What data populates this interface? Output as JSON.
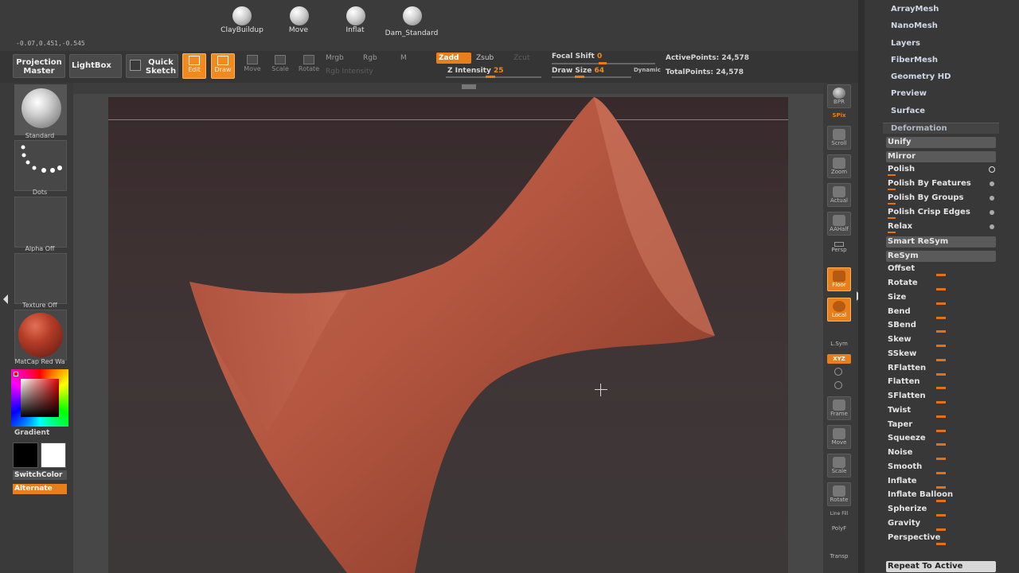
{
  "top_shelf": {
    "brushes": [
      "ClayBuildup",
      "Move",
      "Inflat",
      "Dam_Standard"
    ],
    "coords": "-0.07,0.451,-0.545"
  },
  "toolbar": {
    "projection_master": "Projection Master",
    "lightbox": "LightBox",
    "quick_sketch": "Quick Sketch",
    "edit": "Edit",
    "draw": "Draw",
    "move": "Move",
    "scale": "Scale",
    "rotate": "Rotate",
    "mrgb": "Mrgb",
    "rgb": "Rgb",
    "m": "M",
    "rgb_intensity": "Rgb Intensity",
    "zadd": "Zadd",
    "zsub": "Zsub",
    "zcut": "Zcut",
    "z_intensity_label": "Z Intensity",
    "z_intensity_value": "25",
    "focal_shift_label": "Focal Shift",
    "focal_shift_value": "0",
    "draw_size_label": "Draw Size",
    "draw_size_value": "64",
    "dynamic": "Dynamic",
    "active_points_label": "ActivePoints:",
    "active_points_value": "24,578",
    "total_points_label": "TotalPoints:",
    "total_points_value": "24,578"
  },
  "left_panel": {
    "brush": "Standard",
    "stroke": "Dots",
    "alpha": "Alpha  Off",
    "texture": "Texture  Off",
    "material": "MatCap  Red  Wa",
    "gradient": "Gradient",
    "switch_color": "SwitchColor",
    "alternate": "Alternate",
    "main_color": "#000000",
    "secondary_color": "#ffffff"
  },
  "right_shelf": {
    "bpr": "BPR",
    "spix": "SPix",
    "scroll": "Scroll",
    "zoom": "Zoom",
    "actual": "Actual",
    "aahalf": "AAHalf",
    "persp": "Persp",
    "floor": "Floor",
    "local": "Local",
    "lsym": "L.Sym",
    "xyz": "XYZ",
    "frame": "Frame",
    "move": "Move",
    "scale": "Scale",
    "rotate": "Rotate",
    "polyf": "PolyF",
    "transp": "Transp",
    "line_fill": "Line Fill"
  },
  "palette": {
    "subpalettes": [
      "ArrayMesh",
      "NanoMesh",
      "Layers",
      "FiberMesh",
      "Geometry HD",
      "Preview",
      "Surface"
    ],
    "deformation_title": "Deformation",
    "unify": "Unify",
    "mirror": "Mirror",
    "polish": "Polish",
    "polish_by_features": "Polish By Features",
    "polish_by_groups": "Polish By Groups",
    "polish_crisp_edges": "Polish Crisp Edges",
    "relax": "Relax",
    "smart_resym": "Smart ReSym",
    "resym": "ReSym",
    "sliders": [
      "Offset",
      "Rotate",
      "Size",
      "Bend",
      "SBend",
      "Skew",
      "SSkew",
      "RFlatten",
      "Flatten",
      "SFlatten",
      "Twist",
      "Taper",
      "Squeeze",
      "Noise",
      "Smooth",
      "Inflate",
      "Inflate Balloon",
      "Spherize",
      "Gravity",
      "Perspective"
    ],
    "repeat_to_active": "Repeat To Active"
  }
}
